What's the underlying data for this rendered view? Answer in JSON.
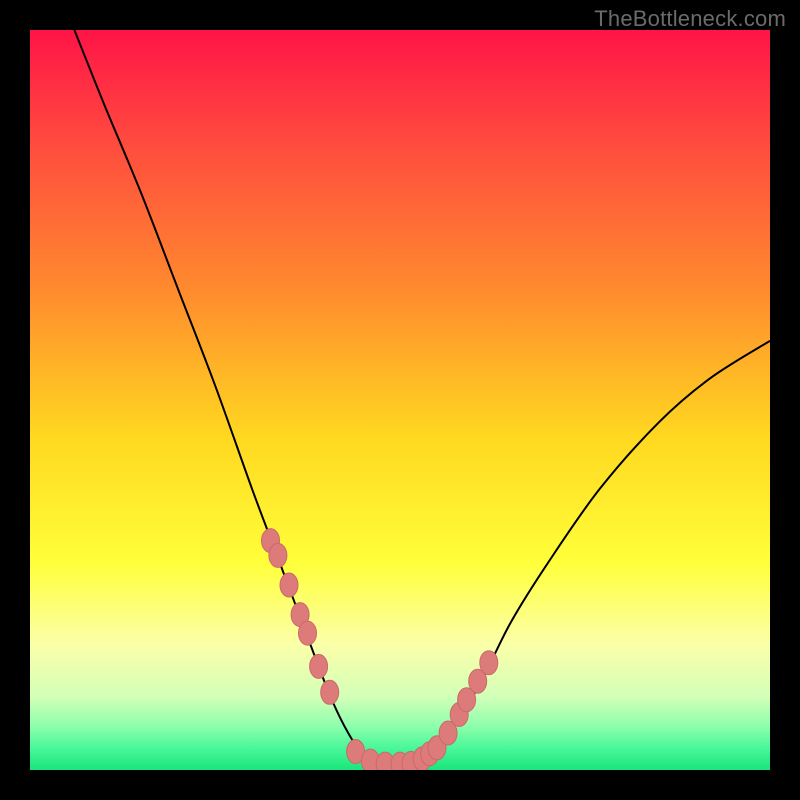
{
  "attribution": "TheBottleneck.com",
  "colors": {
    "frame": "#000000",
    "curve": "#000000",
    "marker_fill": "#dd7a7a",
    "marker_stroke": "#c96a6a",
    "gradient_stops": [
      {
        "offset": 0.0,
        "color": "#ff1447"
      },
      {
        "offset": 0.15,
        "color": "#ff4a3f"
      },
      {
        "offset": 0.35,
        "color": "#ff8a2e"
      },
      {
        "offset": 0.55,
        "color": "#ffd820"
      },
      {
        "offset": 0.72,
        "color": "#ffff3a"
      },
      {
        "offset": 0.83,
        "color": "#fbffa8"
      },
      {
        "offset": 0.9,
        "color": "#d4ffb8"
      },
      {
        "offset": 0.94,
        "color": "#8fffad"
      },
      {
        "offset": 0.97,
        "color": "#4bf79a"
      },
      {
        "offset": 1.0,
        "color": "#19e57a"
      }
    ]
  },
  "chart_data": {
    "type": "line",
    "title": "",
    "xlabel": "",
    "ylabel": "",
    "xlim": [
      0,
      100
    ],
    "ylim": [
      0,
      100
    ],
    "series": [
      {
        "name": "bottleneck-curve",
        "x": [
          6,
          10,
          15,
          20,
          25,
          30,
          33,
          36,
          39,
          41,
          43,
          45,
          47,
          49,
          51,
          53,
          55,
          58,
          61,
          65,
          70,
          77,
          85,
          92,
          100
        ],
        "y": [
          100,
          90,
          78,
          65,
          52,
          38,
          30,
          22,
          14,
          9,
          5,
          2,
          1,
          0.5,
          0.5,
          1,
          3,
          7,
          12,
          20,
          28,
          38,
          47,
          53,
          58
        ]
      }
    ],
    "markers": {
      "name": "highlight-points",
      "x": [
        32.5,
        33.5,
        35,
        36.5,
        37.5,
        39,
        40.5,
        44,
        46,
        48,
        50,
        51.5,
        53,
        54,
        55,
        56.5,
        58,
        59,
        60.5,
        62
      ],
      "y": [
        31,
        29,
        25,
        21,
        18.5,
        14,
        10.5,
        2.5,
        1.2,
        0.8,
        0.8,
        0.9,
        1.5,
        2.2,
        3,
        5,
        7.5,
        9.5,
        12,
        14.5
      ]
    }
  }
}
